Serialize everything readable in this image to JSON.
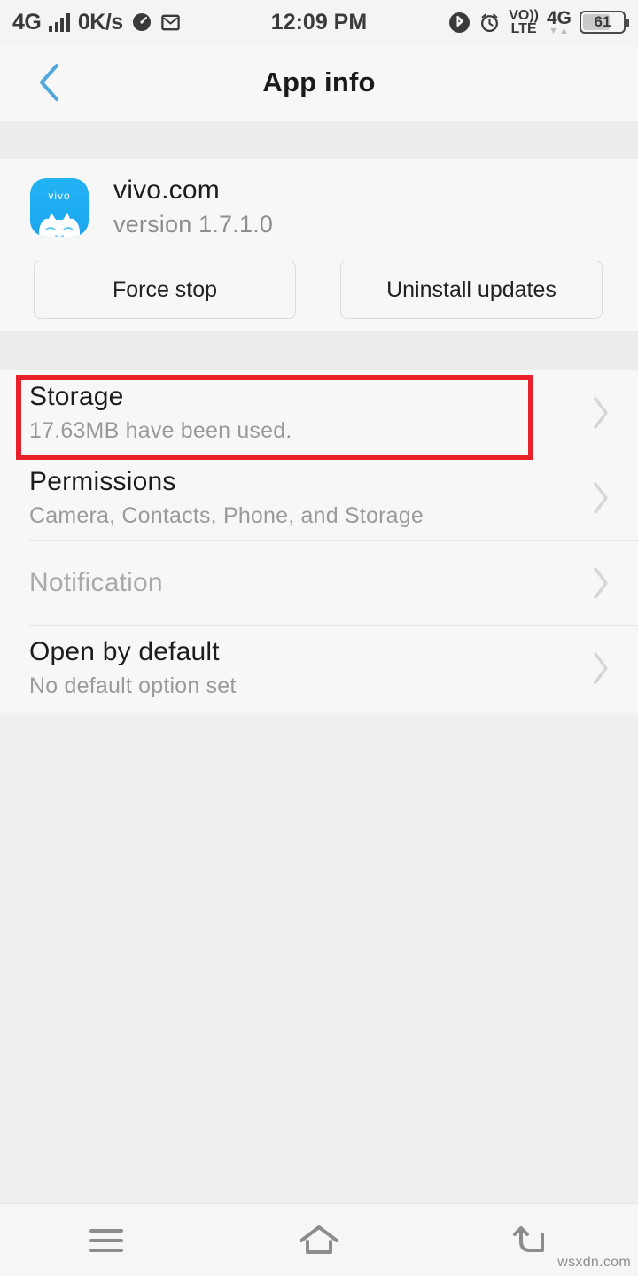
{
  "status_bar": {
    "network_type": "4G",
    "data_rate": "0K/s",
    "icons_left": [
      "signal-bars-icon",
      "speedometer-icon",
      "mail-icon"
    ],
    "time": "12:09 PM",
    "icons_right": [
      "bluetooth-icon",
      "alarm-icon"
    ],
    "volte_line1": "VO))",
    "volte_line2": "LTE",
    "network_type_right": "4G",
    "data_arrows": "▼▲",
    "battery_level": "61"
  },
  "header": {
    "back_icon": "chevron-left-icon",
    "title": "App info",
    "back_color": "#4fa8dc"
  },
  "app": {
    "icon_name": "vivo-app-icon",
    "icon_wordmark": "vivo",
    "name": "vivo.com",
    "version": "version 1.7.1.0",
    "icon_color": "#1fb0f2",
    "buttons": [
      {
        "label": "Force stop",
        "name": "force-stop-button"
      },
      {
        "label": "Uninstall updates",
        "name": "uninstall-updates-button"
      }
    ]
  },
  "list": {
    "rows": [
      {
        "title": "Storage",
        "subtitle": "17.63MB have been used.",
        "name": "list-item-storage",
        "disabled": false,
        "highlighted": true
      },
      {
        "title": "Permissions",
        "subtitle": "Camera, Contacts, Phone, and Storage",
        "name": "list-item-permissions",
        "disabled": false,
        "highlighted": false
      },
      {
        "title": "Notification",
        "subtitle": "",
        "name": "list-item-notification",
        "disabled": true,
        "highlighted": false
      },
      {
        "title": "Open by default",
        "subtitle": "No default option set",
        "name": "list-item-open-by-default",
        "disabled": false,
        "highlighted": false
      }
    ],
    "chevron_icon": "chevron-right-icon",
    "highlight_color": "#e8202a"
  },
  "nav_bar": {
    "recents_icon": "menu-icon",
    "home_icon": "home-icon",
    "back_icon": "back-arrow-icon"
  },
  "watermark": "wsxdn.com"
}
